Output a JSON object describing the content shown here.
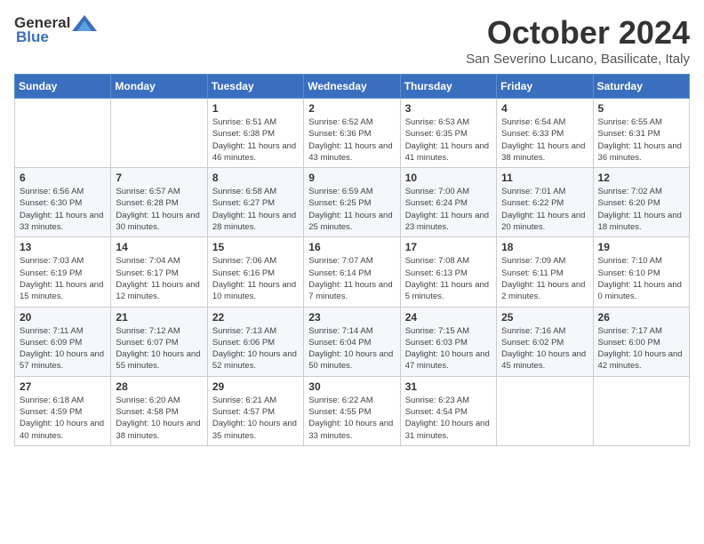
{
  "header": {
    "logo_general": "General",
    "logo_blue": "Blue",
    "month_title": "October 2024",
    "location": "San Severino Lucano, Basilicate, Italy"
  },
  "days_of_week": [
    "Sunday",
    "Monday",
    "Tuesday",
    "Wednesday",
    "Thursday",
    "Friday",
    "Saturday"
  ],
  "weeks": [
    [
      {
        "day": "",
        "info": ""
      },
      {
        "day": "",
        "info": ""
      },
      {
        "day": "1",
        "info": "Sunrise: 6:51 AM\nSunset: 6:38 PM\nDaylight: 11 hours and 46 minutes."
      },
      {
        "day": "2",
        "info": "Sunrise: 6:52 AM\nSunset: 6:36 PM\nDaylight: 11 hours and 43 minutes."
      },
      {
        "day": "3",
        "info": "Sunrise: 6:53 AM\nSunset: 6:35 PM\nDaylight: 11 hours and 41 minutes."
      },
      {
        "day": "4",
        "info": "Sunrise: 6:54 AM\nSunset: 6:33 PM\nDaylight: 11 hours and 38 minutes."
      },
      {
        "day": "5",
        "info": "Sunrise: 6:55 AM\nSunset: 6:31 PM\nDaylight: 11 hours and 36 minutes."
      }
    ],
    [
      {
        "day": "6",
        "info": "Sunrise: 6:56 AM\nSunset: 6:30 PM\nDaylight: 11 hours and 33 minutes."
      },
      {
        "day": "7",
        "info": "Sunrise: 6:57 AM\nSunset: 6:28 PM\nDaylight: 11 hours and 30 minutes."
      },
      {
        "day": "8",
        "info": "Sunrise: 6:58 AM\nSunset: 6:27 PM\nDaylight: 11 hours and 28 minutes."
      },
      {
        "day": "9",
        "info": "Sunrise: 6:59 AM\nSunset: 6:25 PM\nDaylight: 11 hours and 25 minutes."
      },
      {
        "day": "10",
        "info": "Sunrise: 7:00 AM\nSunset: 6:24 PM\nDaylight: 11 hours and 23 minutes."
      },
      {
        "day": "11",
        "info": "Sunrise: 7:01 AM\nSunset: 6:22 PM\nDaylight: 11 hours and 20 minutes."
      },
      {
        "day": "12",
        "info": "Sunrise: 7:02 AM\nSunset: 6:20 PM\nDaylight: 11 hours and 18 minutes."
      }
    ],
    [
      {
        "day": "13",
        "info": "Sunrise: 7:03 AM\nSunset: 6:19 PM\nDaylight: 11 hours and 15 minutes."
      },
      {
        "day": "14",
        "info": "Sunrise: 7:04 AM\nSunset: 6:17 PM\nDaylight: 11 hours and 12 minutes."
      },
      {
        "day": "15",
        "info": "Sunrise: 7:06 AM\nSunset: 6:16 PM\nDaylight: 11 hours and 10 minutes."
      },
      {
        "day": "16",
        "info": "Sunrise: 7:07 AM\nSunset: 6:14 PM\nDaylight: 11 hours and 7 minutes."
      },
      {
        "day": "17",
        "info": "Sunrise: 7:08 AM\nSunset: 6:13 PM\nDaylight: 11 hours and 5 minutes."
      },
      {
        "day": "18",
        "info": "Sunrise: 7:09 AM\nSunset: 6:11 PM\nDaylight: 11 hours and 2 minutes."
      },
      {
        "day": "19",
        "info": "Sunrise: 7:10 AM\nSunset: 6:10 PM\nDaylight: 11 hours and 0 minutes."
      }
    ],
    [
      {
        "day": "20",
        "info": "Sunrise: 7:11 AM\nSunset: 6:09 PM\nDaylight: 10 hours and 57 minutes."
      },
      {
        "day": "21",
        "info": "Sunrise: 7:12 AM\nSunset: 6:07 PM\nDaylight: 10 hours and 55 minutes."
      },
      {
        "day": "22",
        "info": "Sunrise: 7:13 AM\nSunset: 6:06 PM\nDaylight: 10 hours and 52 minutes."
      },
      {
        "day": "23",
        "info": "Sunrise: 7:14 AM\nSunset: 6:04 PM\nDaylight: 10 hours and 50 minutes."
      },
      {
        "day": "24",
        "info": "Sunrise: 7:15 AM\nSunset: 6:03 PM\nDaylight: 10 hours and 47 minutes."
      },
      {
        "day": "25",
        "info": "Sunrise: 7:16 AM\nSunset: 6:02 PM\nDaylight: 10 hours and 45 minutes."
      },
      {
        "day": "26",
        "info": "Sunrise: 7:17 AM\nSunset: 6:00 PM\nDaylight: 10 hours and 42 minutes."
      }
    ],
    [
      {
        "day": "27",
        "info": "Sunrise: 6:18 AM\nSunset: 4:59 PM\nDaylight: 10 hours and 40 minutes."
      },
      {
        "day": "28",
        "info": "Sunrise: 6:20 AM\nSunset: 4:58 PM\nDaylight: 10 hours and 38 minutes."
      },
      {
        "day": "29",
        "info": "Sunrise: 6:21 AM\nSunset: 4:57 PM\nDaylight: 10 hours and 35 minutes."
      },
      {
        "day": "30",
        "info": "Sunrise: 6:22 AM\nSunset: 4:55 PM\nDaylight: 10 hours and 33 minutes."
      },
      {
        "day": "31",
        "info": "Sunrise: 6:23 AM\nSunset: 4:54 PM\nDaylight: 10 hours and 31 minutes."
      },
      {
        "day": "",
        "info": ""
      },
      {
        "day": "",
        "info": ""
      }
    ]
  ]
}
